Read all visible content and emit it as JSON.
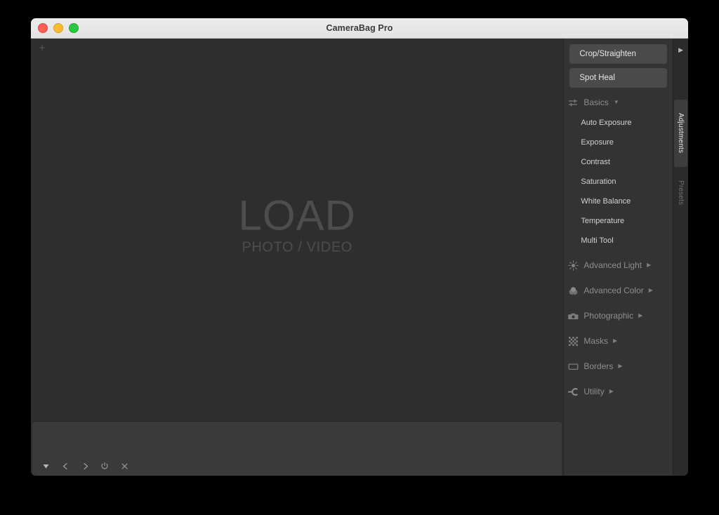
{
  "window": {
    "title": "CameraBag Pro",
    "traffic_lights": [
      "close",
      "minimize",
      "maximize"
    ]
  },
  "canvas": {
    "add_icon": "+",
    "load_title": "LOAD",
    "load_subtitle": "PHOTO / VIDEO"
  },
  "filmstrip": {
    "buttons": [
      {
        "name": "expand-filmstrip",
        "icon": "triangle-down-icon"
      },
      {
        "name": "previous-image",
        "icon": "chevron-left-icon"
      },
      {
        "name": "next-image",
        "icon": "chevron-right-icon"
      },
      {
        "name": "toggle-enabled",
        "icon": "power-icon"
      },
      {
        "name": "close-image",
        "icon": "close-icon"
      }
    ]
  },
  "panel": {
    "tools": [
      {
        "label": "Crop/Straighten",
        "name": "crop-straighten"
      },
      {
        "label": "Spot Heal",
        "name": "spot-heal"
      }
    ],
    "groups": [
      {
        "name": "basics",
        "label": "Basics",
        "icon": "sliders-icon",
        "expanded": true,
        "arrow": "▼",
        "items": [
          "Auto Exposure",
          "Exposure",
          "Contrast",
          "Saturation",
          "White Balance",
          "Temperature",
          "Multi Tool"
        ]
      },
      {
        "name": "advanced-light",
        "label": "Advanced Light",
        "icon": "sun-icon",
        "expanded": false,
        "arrow": "▶",
        "items": []
      },
      {
        "name": "advanced-color",
        "label": "Advanced Color",
        "icon": "color-blobs-icon",
        "expanded": false,
        "arrow": "▶",
        "items": []
      },
      {
        "name": "photographic",
        "label": "Photographic",
        "icon": "camera-icon",
        "expanded": false,
        "arrow": "▶",
        "items": []
      },
      {
        "name": "masks",
        "label": "Masks",
        "icon": "checkerboard-icon",
        "expanded": false,
        "arrow": "▶",
        "items": []
      },
      {
        "name": "borders",
        "label": "Borders",
        "icon": "rectangle-icon",
        "expanded": false,
        "arrow": "▶",
        "items": []
      },
      {
        "name": "utility",
        "label": "Utility",
        "icon": "node-connector-icon",
        "expanded": false,
        "arrow": "▶",
        "items": []
      }
    ]
  },
  "rail": {
    "collapse_icon": "▶",
    "tabs": [
      {
        "label": "Adjustments",
        "name": "adjustments",
        "active": true
      },
      {
        "label": "Presets",
        "name": "presets",
        "active": false
      }
    ]
  },
  "colors": {
    "window_chrome": "#ececec",
    "canvas_bg": "#2e2e2e",
    "panel_bg": "#333333",
    "tool_button_bg": "#4a4a4a",
    "active_tab_bg": "#3d3d3d",
    "traffic_close": "#ff5f57",
    "traffic_min": "#febc2e",
    "traffic_max": "#28c840"
  }
}
